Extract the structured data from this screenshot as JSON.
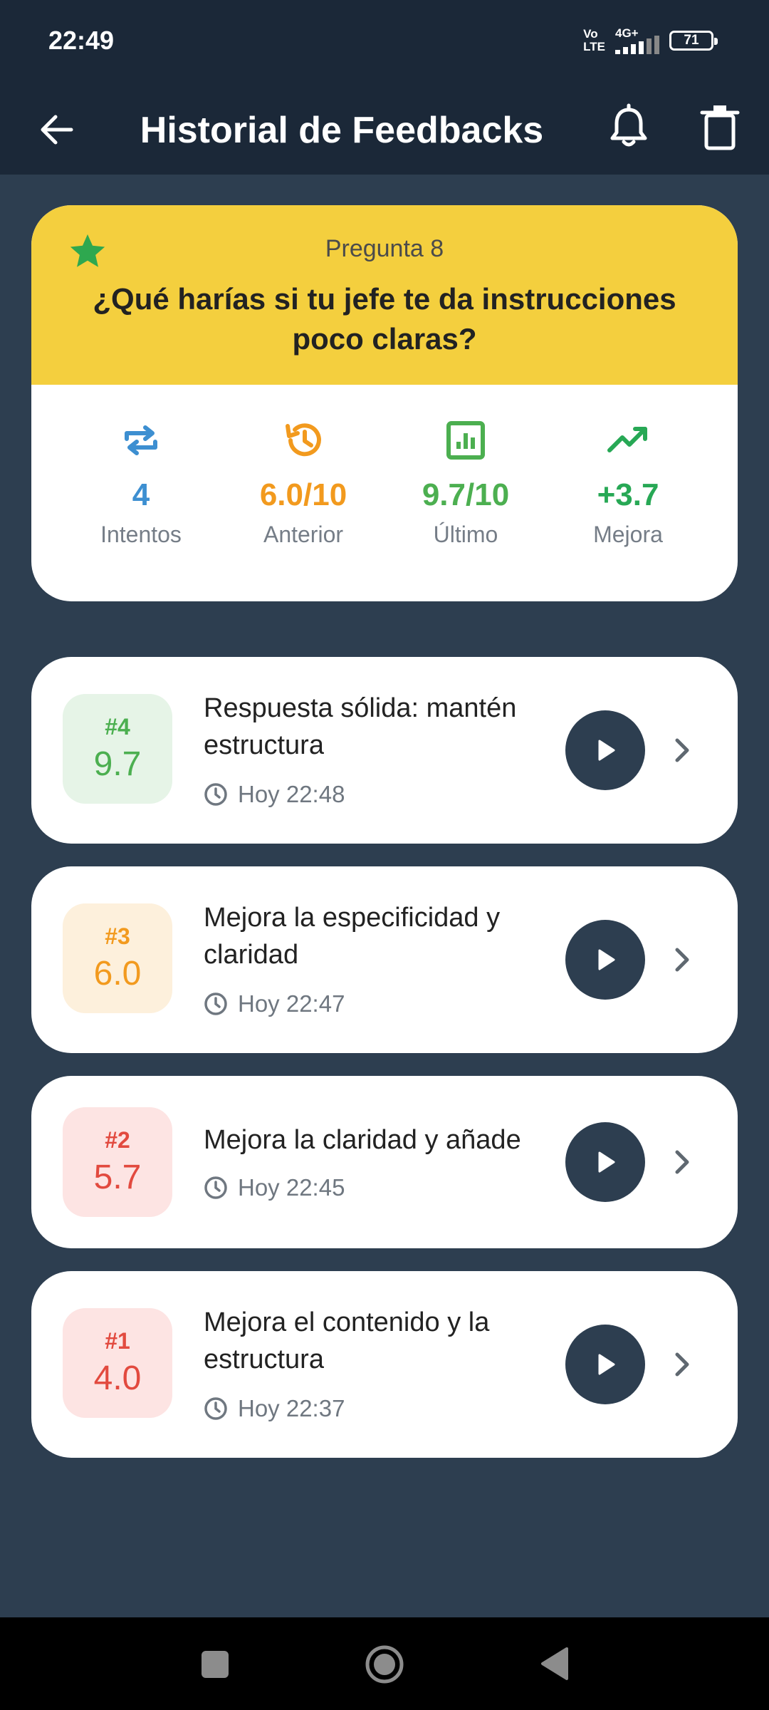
{
  "status": {
    "time": "22:49",
    "network_top": "Vo",
    "network_bottom": "LTE",
    "network_type": "4G+",
    "battery": "71"
  },
  "appbar": {
    "title": "Historial de Feedbacks",
    "icons": [
      "back-arrow-icon",
      "bell-icon",
      "trash-icon"
    ]
  },
  "question": {
    "number_label": "Pregunta 8",
    "text": "¿Qué harías si tu jefe te da instrucciones poco claras?",
    "colors": {
      "header": "#f4cf3e",
      "star": "#2ea84f"
    }
  },
  "stats": [
    {
      "value": "4",
      "label": "Intentos",
      "icon": "repeat-icon",
      "color": "#3d8fd1"
    },
    {
      "value": "6.0/10",
      "label": "Anterior",
      "icon": "history-icon",
      "color": "#f29a1e"
    },
    {
      "value": "9.7/10",
      "label": "Último",
      "icon": "chart-icon",
      "color": "#4caf50"
    },
    {
      "value": "+3.7",
      "label": "Mejora",
      "icon": "trending-up-icon",
      "color": "#27a855"
    }
  ],
  "attempts": [
    {
      "num": "#4",
      "score": "9.7",
      "title": "Respuesta sólida: mantén estructura",
      "time": "Hoy 22:48",
      "color": "#4caf50",
      "bg": "#e6f4e7"
    },
    {
      "num": "#3",
      "score": "6.0",
      "title": "Mejora la especificidad y claridad",
      "time": "Hoy 22:47",
      "color": "#f29a1e",
      "bg": "#fdf0dc"
    },
    {
      "num": "#2",
      "score": "5.7",
      "title": "Mejora la claridad y añade",
      "time": "Hoy 22:45",
      "color": "#e24a3f",
      "bg": "#fde4e3"
    },
    {
      "num": "#1",
      "score": "4.0",
      "title": "Mejora el contenido y la estructura",
      "time": "Hoy 22:37",
      "color": "#e24a3f",
      "bg": "#fde4e3"
    }
  ]
}
